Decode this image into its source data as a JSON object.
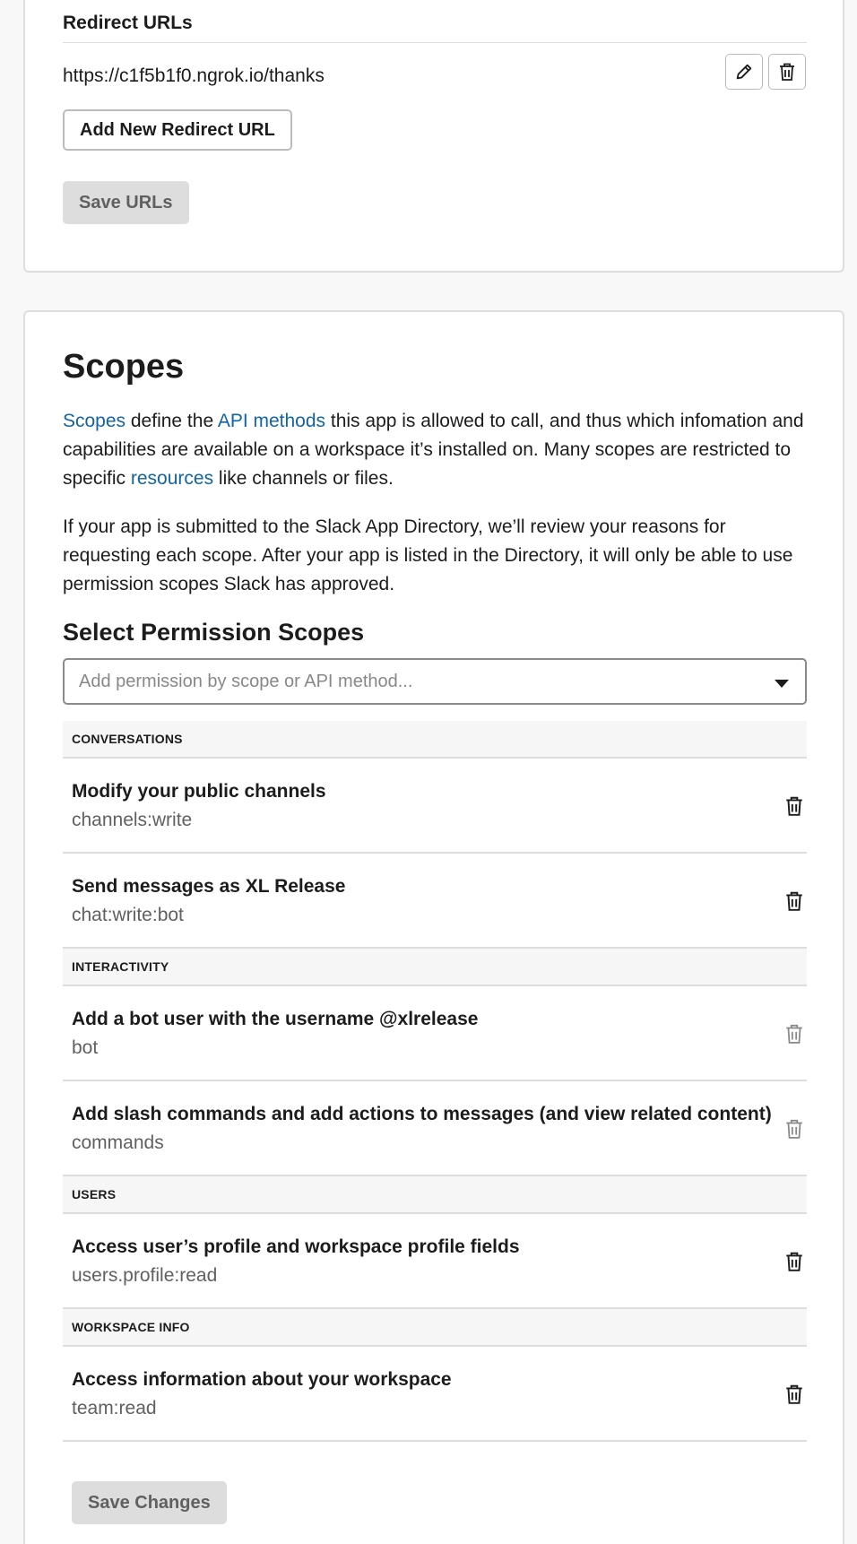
{
  "redirect": {
    "section_label": "Redirect URLs",
    "url": "https://c1f5b1f0.ngrok.io/thanks",
    "add_button": "Add New Redirect URL",
    "save_button": "Save URLs"
  },
  "scopes": {
    "title": "Scopes",
    "intro": {
      "link_scopes": "Scopes",
      "t1": " define the ",
      "link_api": "API methods",
      "t2": " this app is allowed to call, and thus which infomation and capabilities are available on a workspace it’s installed on. Many scopes are restricted to specific ",
      "link_resources": "resources",
      "t3": " like channels or files."
    },
    "review_text": "If your app is submitted to the Slack App Directory, we’ll review your reasons for requesting each scope. After your app is listed in the Directory, it will only be able to use permission scopes Slack has approved.",
    "select_heading": "Select Permission Scopes",
    "select_placeholder": "Add permission by scope or API method...",
    "groups": [
      {
        "name": "CONVERSATIONS",
        "items": [
          {
            "title": "Modify your public channels",
            "code": "channels:write"
          },
          {
            "title": "Send messages as XL Release",
            "code": "chat:write:bot"
          }
        ]
      },
      {
        "name": "INTERACTIVITY",
        "items": [
          {
            "title": "Add a bot user with the username @xlrelease",
            "code": "bot"
          },
          {
            "title": "Add slash commands and add actions to messages (and view related content)",
            "code": "commands"
          }
        ]
      },
      {
        "name": "USERS",
        "items": [
          {
            "title": "Access user’s profile and workspace profile fields",
            "code": "users.profile:read"
          }
        ]
      },
      {
        "name": "WORKSPACE INFO",
        "items": [
          {
            "title": "Access information about your workspace",
            "code": "team:read"
          }
        ]
      }
    ],
    "save_button": "Save Changes"
  },
  "colors": {
    "link": "#1264a3",
    "text": "#1d1c1d",
    "muted": "#616061",
    "disabled_button": "#dddddd",
    "icon_active": "#1d1c1d",
    "icon_muted": "#888888"
  }
}
